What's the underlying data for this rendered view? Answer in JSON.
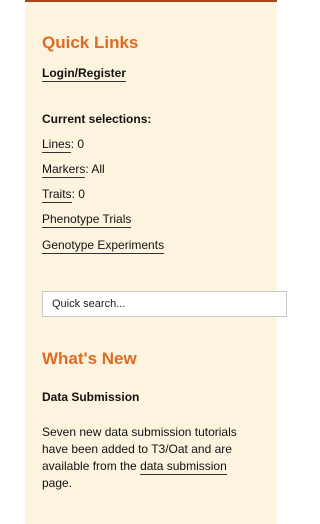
{
  "colors": {
    "sidebar_background": "#fdf4df",
    "heading_orange": "#de6b23",
    "top_border": "#a9441b"
  },
  "quick_links": {
    "title": "Quick Links",
    "login_label": "Login/Register"
  },
  "current_selections": {
    "title": "Current selections:",
    "lines_label": "Lines",
    "lines_value": ": 0",
    "markers_label": "Markers",
    "markers_value": ": All",
    "traits_label": "Traits",
    "traits_value": ": 0",
    "phenotype_trials_label": "Phenotype Trials",
    "genotype_experiments_label": "Genotype Experiments"
  },
  "search": {
    "placeholder": "Quick search..."
  },
  "whats_new": {
    "title": "What's New",
    "item_title": "Data Submission",
    "body_before_link": "Seven new data submission tutorials have been added to T3/Oat and are available from the ",
    "link_label": "data submission",
    "body_after_link": " page."
  }
}
